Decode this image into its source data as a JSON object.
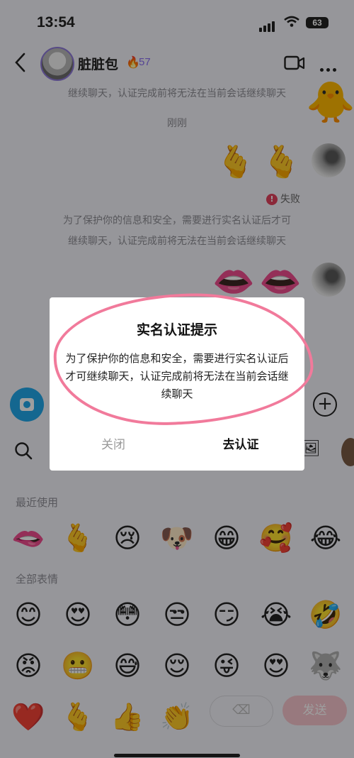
{
  "status_bar": {
    "time": "13:54",
    "battery": "63"
  },
  "header": {
    "contact_name": "脏脏包",
    "intimacy_level": "57",
    "icons": [
      "back-icon",
      "video-call-icon",
      "more-icon"
    ]
  },
  "chat": {
    "system_partial": "继续聊天，认证完成前将无法在当前会话继续聊天",
    "timestamp": "刚刚",
    "sent_emojis_1": [
      "🫰",
      "🫰"
    ],
    "failed_text": "失败",
    "failed_mark": "!",
    "system_line_1": "为了保护你的信息和安全，需要进行实名认证后才可",
    "system_line_2": "继续聊天，认证完成前将无法在当前会话继续聊天",
    "sent_emojis_2": [
      "👄",
      "👄"
    ]
  },
  "emoji_panel": {
    "recent_label": "最近使用",
    "all_label": "全部表情",
    "recent": [
      "🫦",
      "🫰",
      "😢",
      "🐶",
      "😁",
      "🥰",
      "😂"
    ],
    "all_row1": [
      "😊",
      "😍",
      "😳",
      "😒",
      "😏",
      "😭",
      "🤣"
    ],
    "all_row2": [
      "😡",
      "😬",
      "😅",
      "😌",
      "😜",
      "😍",
      "🐺"
    ],
    "all_row3": [
      "❤️",
      "🫰",
      "👍",
      "👏"
    ],
    "send_label": "发送",
    "delete_symbol": "⌫"
  },
  "modal": {
    "title": "实名认证提示",
    "body": "为了保护你的信息和安全，需要进行实名认证后才可继续聊天，认证完成前将无法在当前会话继续聊天",
    "close_label": "关闭",
    "verify_label": "去认证"
  }
}
